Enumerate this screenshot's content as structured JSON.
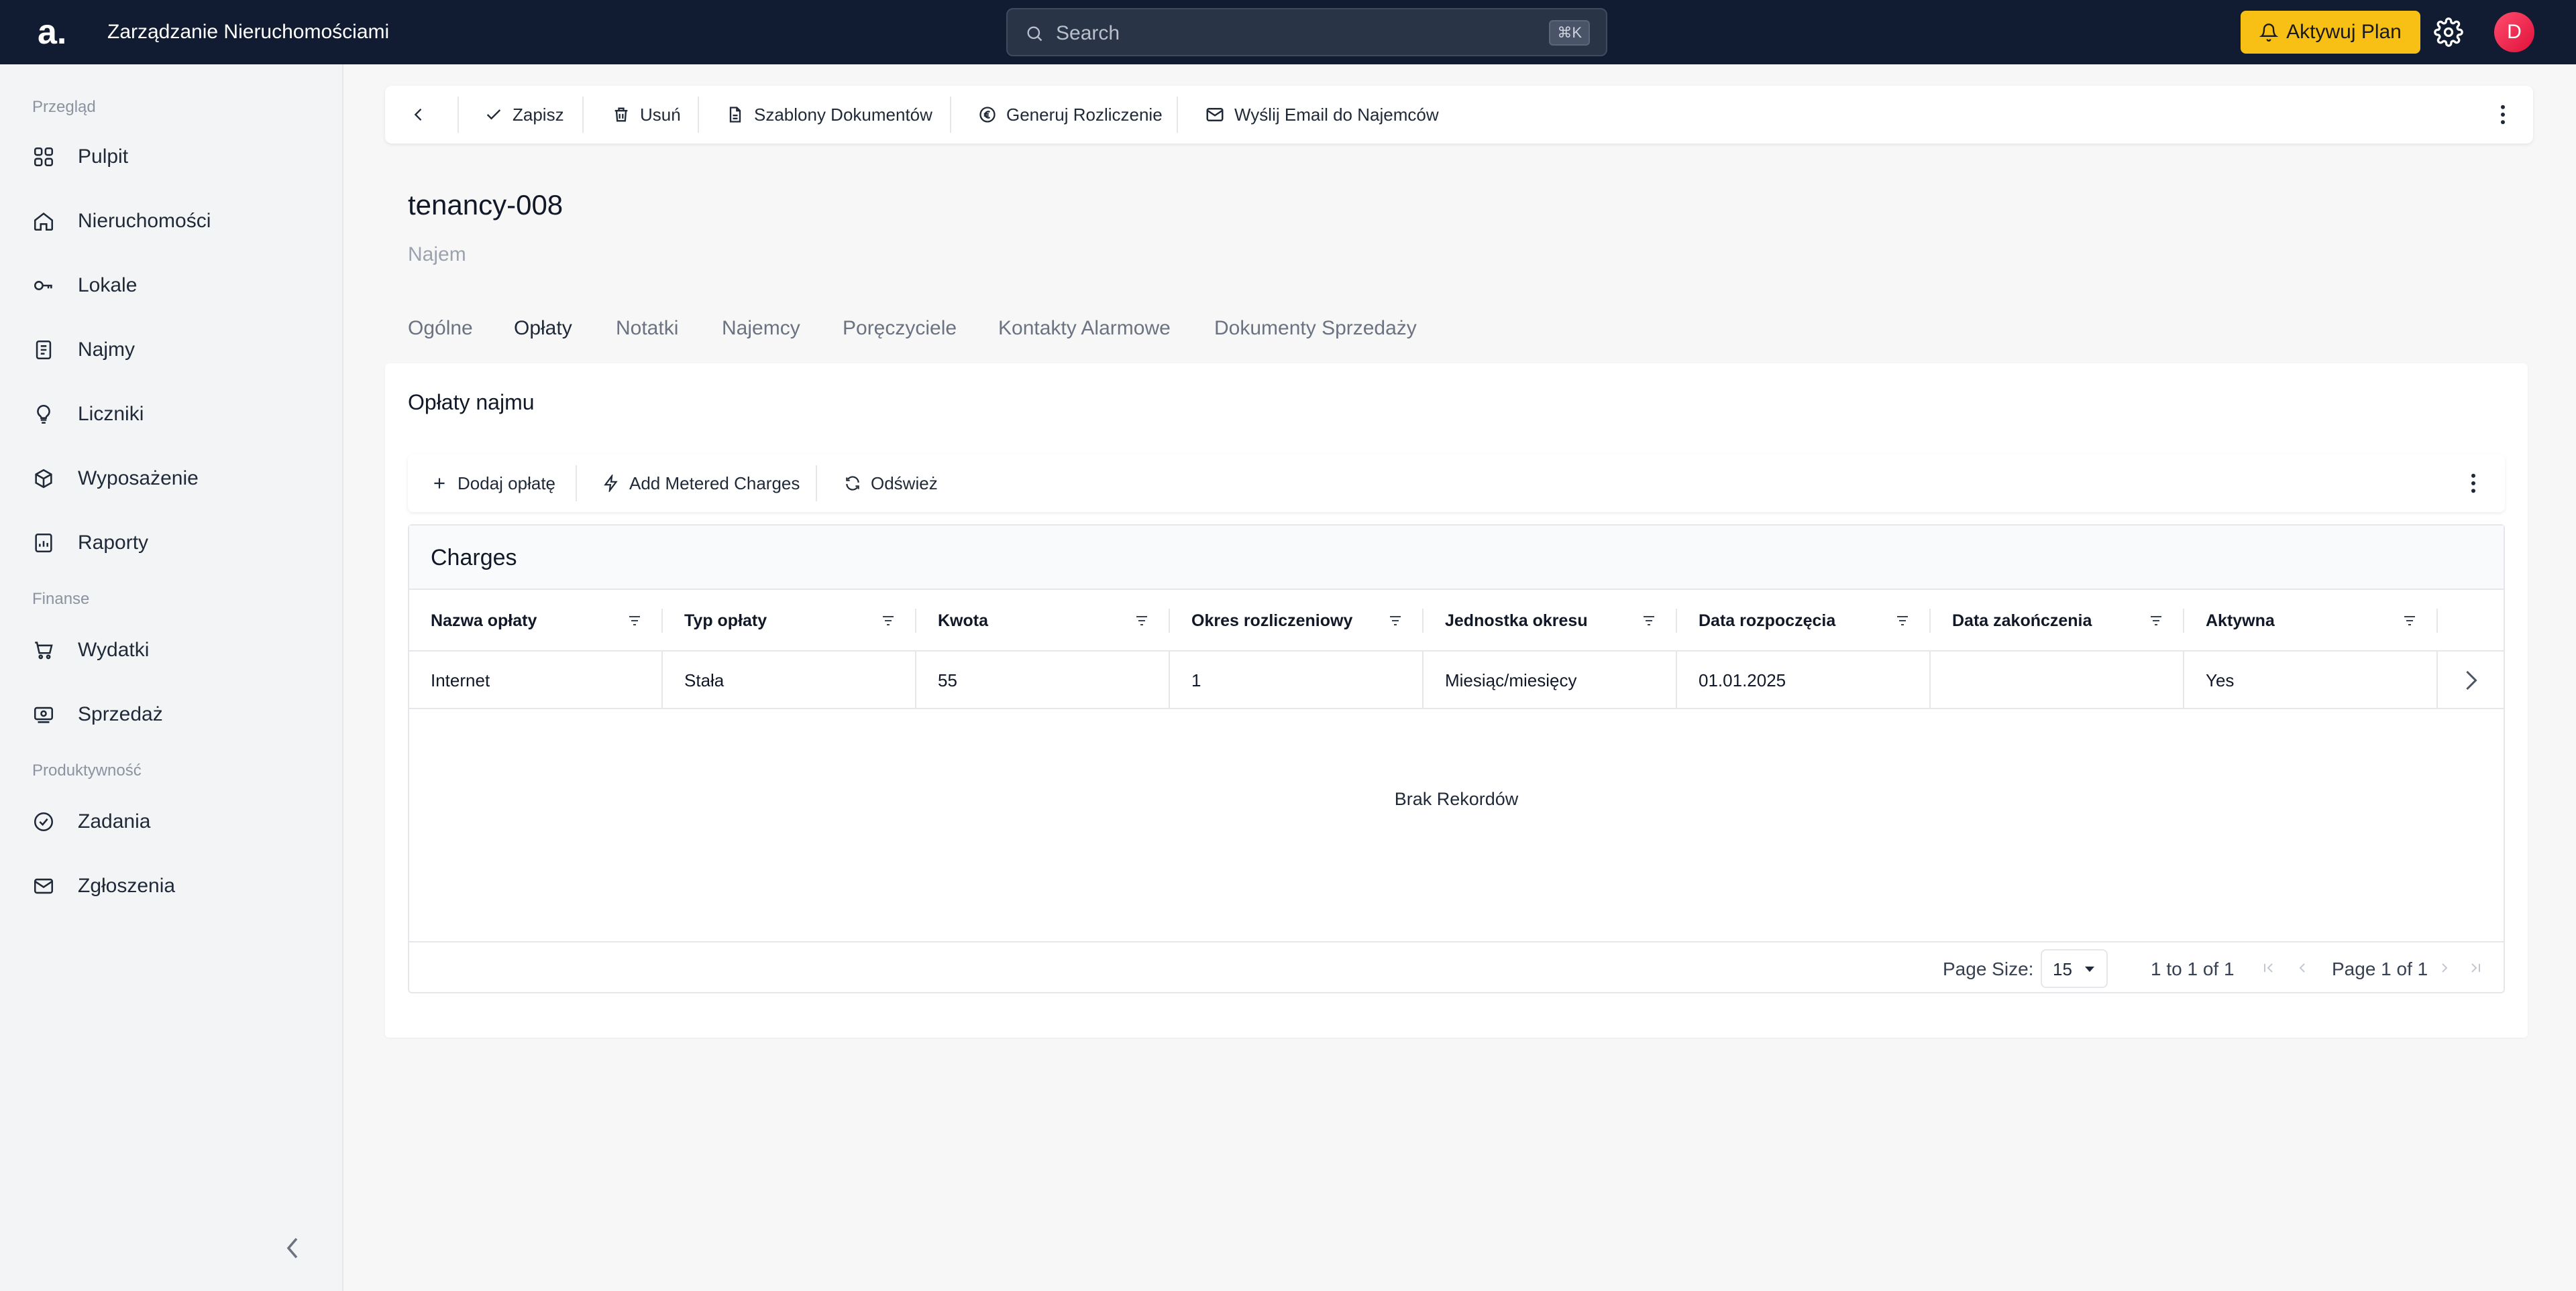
{
  "topbar": {
    "logo": "a.",
    "app_title": "Zarządzanie Nieruchomościami",
    "search_placeholder": "Search",
    "search_shortcut": "⌘K",
    "plan_button": "Aktywuj Plan",
    "avatar_initial": "D"
  },
  "sidebar": {
    "sections": [
      {
        "label": "Przegląd",
        "items": [
          "Pulpit",
          "Nieruchomości",
          "Lokale",
          "Najmy",
          "Liczniki",
          "Wyposażenie",
          "Raporty"
        ]
      },
      {
        "label": "Finanse",
        "items": [
          "Wydatki",
          "Sprzedaż"
        ]
      },
      {
        "label": "Produktywność",
        "items": [
          "Zadania",
          "Zgłoszenia"
        ]
      }
    ]
  },
  "toolbar": {
    "save": "Zapisz",
    "delete": "Usuń",
    "templates": "Szablony Dokumentów",
    "generate_settlement": "Generuj Rozliczenie",
    "email_tenants": "Wyślij Email do Najemców"
  },
  "record": {
    "title": "tenancy-008",
    "subtitle": "Najem"
  },
  "tabs": [
    "Ogólne",
    "Opłaty",
    "Notatki",
    "Najemcy",
    "Poręczyciele",
    "Kontakty Alarmowe",
    "Dokumenty Sprzedaży"
  ],
  "active_tab": "Opłaty",
  "panel": {
    "title": "Opłaty najmu",
    "actions": {
      "add_charge": "Dodaj opłatę",
      "add_metered": "Add Metered Charges",
      "refresh": "Odśwież"
    }
  },
  "grid": {
    "title": "Charges",
    "columns": [
      "Nazwa opłaty",
      "Typ opłaty",
      "Kwota",
      "Okres rozliczeniowy",
      "Jednostka okresu",
      "Data rozpoczęcia",
      "Data zakończenia",
      "Aktywna"
    ],
    "rows": [
      [
        "Internet",
        "Stała",
        "55",
        "1",
        "Miesiąc/miesięcy",
        "01.01.2025",
        "",
        "Yes"
      ]
    ],
    "empty_message": "Brak Rekordów",
    "footer": {
      "page_size_label": "Page Size:",
      "page_size": "15",
      "range": "1 to 1 of 1",
      "page": "Page 1 of 1"
    }
  },
  "colors": {
    "topbar_bg": "#111c33",
    "accent_yellow": "#f8c015",
    "avatar": "#ef2b4f"
  }
}
